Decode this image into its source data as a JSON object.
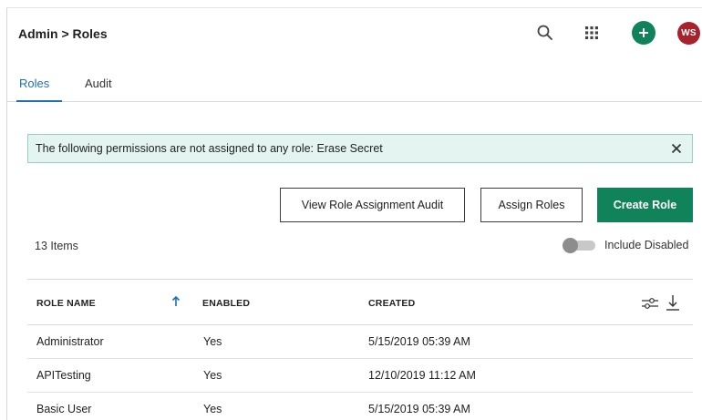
{
  "header": {
    "breadcrumb": "Admin > Roles",
    "avatar_initials": "WS",
    "icons": [
      "search-icon",
      "apps-grid-icon",
      "add-icon"
    ],
    "accent_green": "#11835a",
    "avatar_color": "#a8222b"
  },
  "tabs": [
    {
      "label": "Roles",
      "active": true
    },
    {
      "label": "Audit",
      "active": false
    }
  ],
  "alert": {
    "text": "The following permissions are not assigned to any role: Erase Secret",
    "close_icon": "close-icon"
  },
  "actions": {
    "view_audit_label": "View Role Assignment Audit",
    "assign_roles_label": "Assign Roles",
    "create_role_label": "Create Role"
  },
  "list": {
    "count_label": "13 Items",
    "include_disabled_label": "Include Disabled",
    "include_disabled_on": false
  },
  "table": {
    "columns": {
      "name": "ROLE NAME",
      "enabled": "ENABLED",
      "created": "CREATED"
    },
    "sort": {
      "column": "name",
      "direction": "ascending",
      "icon": "sort-arrow-up-icon"
    },
    "tool_icons": [
      "column-settings-icon",
      "export-download-icon"
    ],
    "rows": [
      {
        "name": "Administrator",
        "enabled": "Yes",
        "created": "5/15/2019 05:39 AM"
      },
      {
        "name": "APITesting",
        "enabled": "Yes",
        "created": "12/10/2019 11:12 AM"
      },
      {
        "name": "Basic User",
        "enabled": "Yes",
        "created": "5/15/2019 05:39 AM"
      }
    ]
  }
}
